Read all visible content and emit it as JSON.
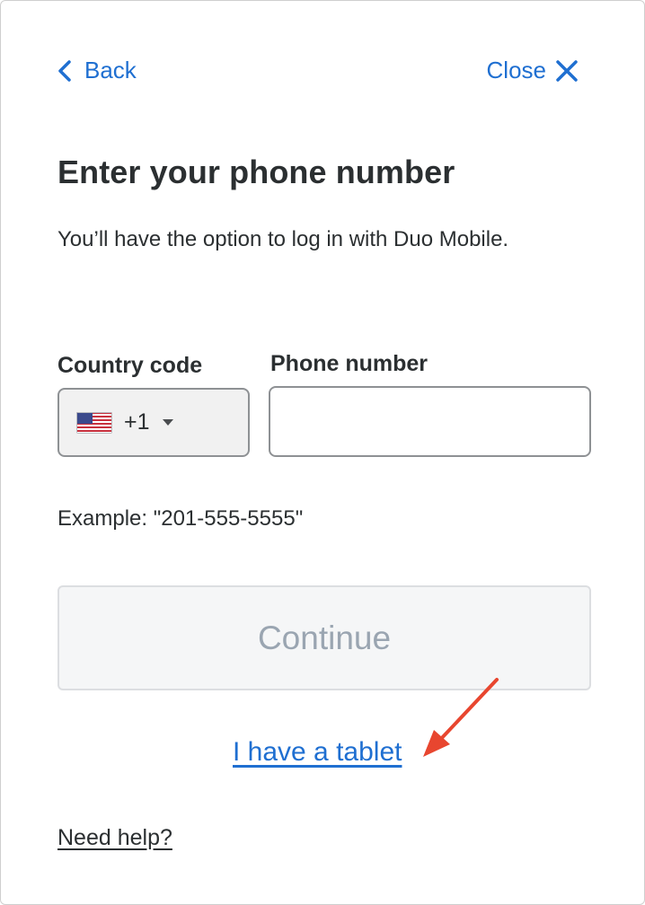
{
  "nav": {
    "back_label": "Back",
    "close_label": "Close"
  },
  "heading": {
    "title": "Enter your phone number",
    "subtitle": "You’ll have the option to log in with Duo Mobile."
  },
  "form": {
    "country_code_label": "Country code",
    "country_code_value": "+1",
    "country_flag": "us-flag-icon",
    "phone_label": "Phone number",
    "phone_value": "",
    "example_text": "Example: \"201-555-5555\""
  },
  "actions": {
    "continue_label": "Continue",
    "tablet_link": "I have a tablet",
    "help_link": "Need help?"
  },
  "colors": {
    "link_blue": "#1f6fd1",
    "annotation_arrow": "#e8462f",
    "disabled_text": "#9aa5b1"
  }
}
